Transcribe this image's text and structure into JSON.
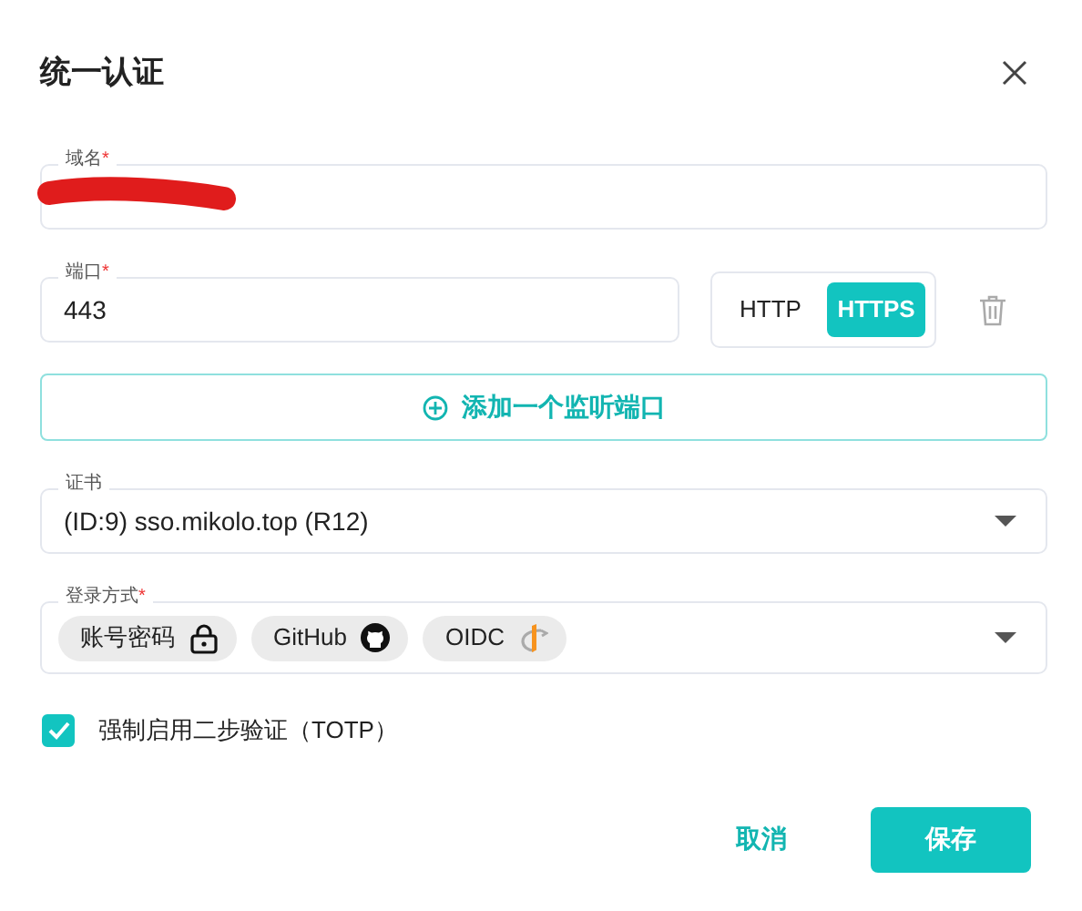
{
  "dialog": {
    "title": "统一认证"
  },
  "domain_field": {
    "label": "域名",
    "required_mark": "*",
    "redacted": true
  },
  "port_field": {
    "label": "端口",
    "required_mark": "*",
    "value": "443"
  },
  "protocols": [
    {
      "label": "HTTP",
      "selected": false
    },
    {
      "label": "HTTPS",
      "selected": true
    }
  ],
  "add_port_button": {
    "label": "添加一个监听端口"
  },
  "certificate_field": {
    "label": "证书",
    "value": "(ID:9) sso.mikolo.top (R12)"
  },
  "login_methods_field": {
    "label": "登录方式",
    "required_mark": "*",
    "chips": [
      {
        "label": "账号密码",
        "kind": "lock"
      },
      {
        "label": "GitHub",
        "kind": "github"
      },
      {
        "label": "OIDC",
        "kind": "oidc"
      }
    ]
  },
  "totp": {
    "label": "强制启用二步验证（TOTP）",
    "checked": true
  },
  "buttons": [
    {
      "label": "取消",
      "kind": "text"
    },
    {
      "label": "保存",
      "kind": "primary"
    }
  ]
}
